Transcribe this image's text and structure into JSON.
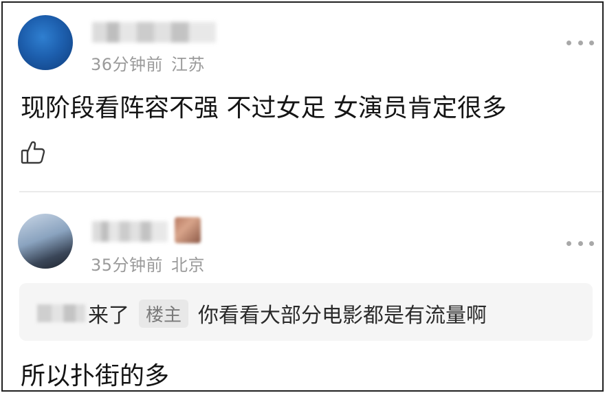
{
  "comments": [
    {
      "time": "36分钟前",
      "location": "江苏",
      "text": "现阶段看阵容不强  不过女足 女演员肯定很多",
      "more_icon": "more-dots-icon",
      "like_icon": "thumbs-up-icon"
    },
    {
      "time": "35分钟前",
      "location": "北京",
      "quote": {
        "suffix": "来了",
        "owner_tag": "楼主",
        "text": "你看看大部分电影都是有流量啊"
      },
      "text": "所以扑街的多",
      "more_icon": "more-dots-icon"
    }
  ],
  "colors": {
    "meta_text": "#9a9a9a",
    "body_text": "#141414",
    "quote_bg": "#f5f5f5",
    "divider": "#eaeaea"
  }
}
